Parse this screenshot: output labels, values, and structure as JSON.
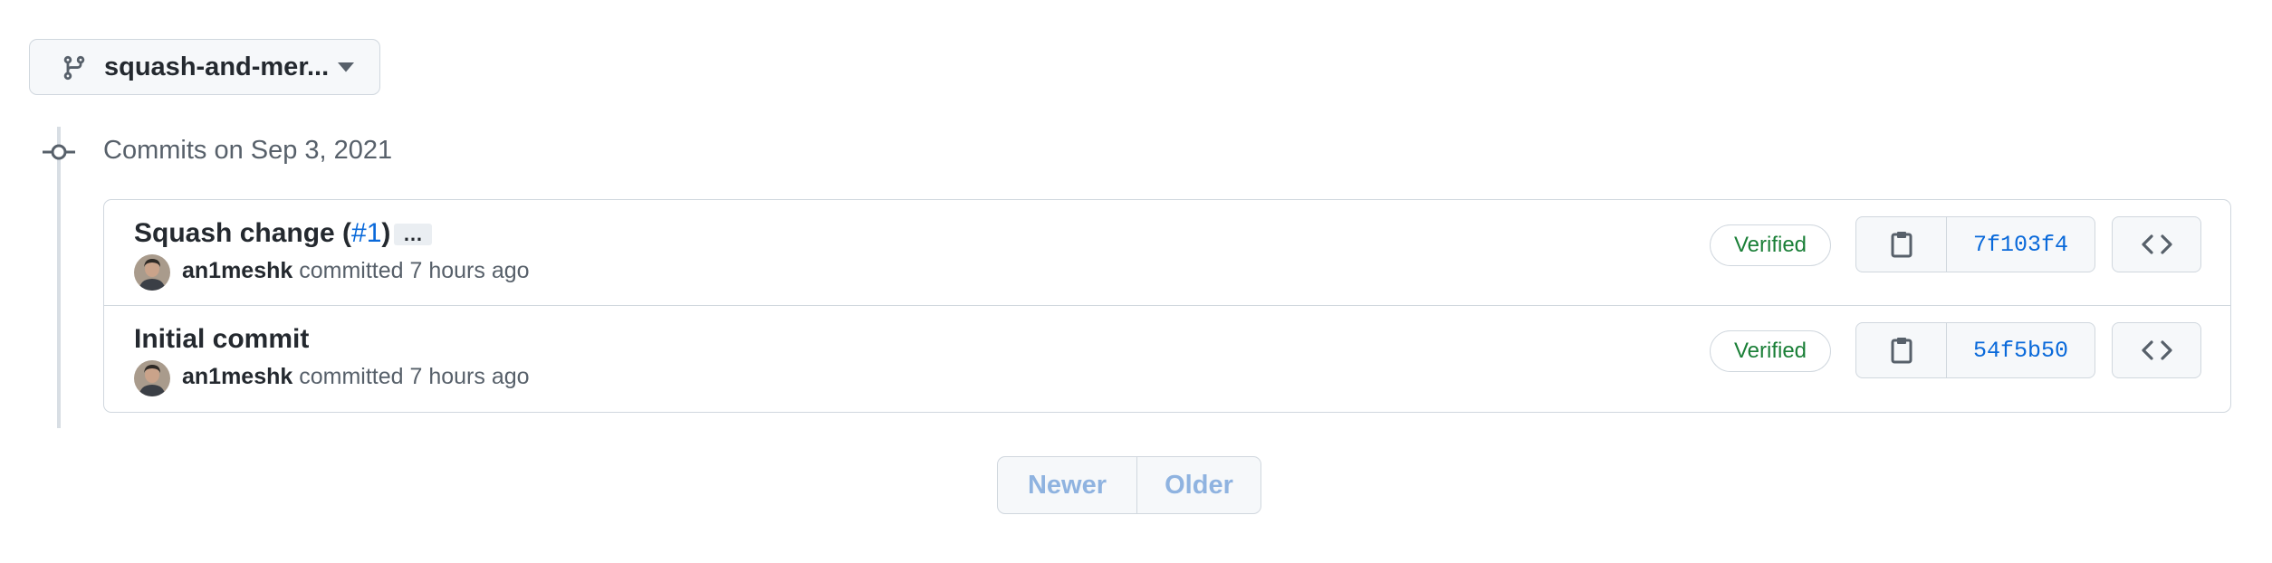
{
  "branch_selector": {
    "name": "squash-and-mer...",
    "icon": "git-branch-icon"
  },
  "timeline": {
    "date_heading": "Commits on Sep 3, 2021"
  },
  "commits": [
    {
      "title": "Squash change (",
      "pr_ref": "#1",
      "title_suffix": ")",
      "has_ellipsis": true,
      "ellipsis": "…",
      "author": "an1meshk",
      "committed_text": " committed 7 hours ago",
      "verified": "Verified",
      "sha": "7f103f4"
    },
    {
      "title": "Initial commit",
      "author": "an1meshk",
      "committed_text": " committed 7 hours ago",
      "verified": "Verified",
      "sha": "54f5b50"
    }
  ],
  "pagination": {
    "newer": "Newer",
    "older": "Older",
    "newer_disabled": true,
    "older_disabled": true
  },
  "colors": {
    "link": "#0969da",
    "verified_green": "#1a7f37",
    "border": "#d0d7de",
    "muted_text": "#57606a"
  }
}
